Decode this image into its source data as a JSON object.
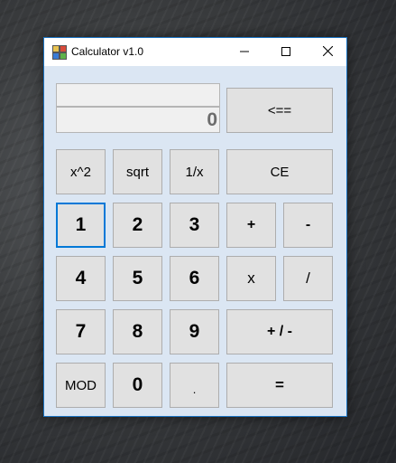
{
  "window": {
    "title": "Calculator v1.0"
  },
  "display": {
    "expression": "",
    "value": "0"
  },
  "buttons": {
    "backspace": "<==",
    "square": "x^2",
    "sqrt": "sqrt",
    "reciprocal": "1/x",
    "clear_entry": "CE",
    "one": "1",
    "two": "2",
    "three": "3",
    "plus": "+",
    "minus": "-",
    "four": "4",
    "five": "5",
    "six": "6",
    "multiply": "x",
    "divide": "/",
    "seven": "7",
    "eight": "8",
    "nine": "9",
    "negate": "+ / -",
    "mod": "MOD",
    "zero": "0",
    "decimal": ".",
    "equals": "="
  },
  "icons": {
    "app": "calculator-app-icon",
    "minimize": "minimize-icon",
    "maximize": "maximize-icon",
    "close": "close-icon"
  },
  "colors": {
    "window_bg": "#dbe6f3",
    "window_border": "#1c75c4",
    "button_bg": "#e1e1e1",
    "focus_border": "#0078d7",
    "display_text": "#6d6d6d"
  }
}
